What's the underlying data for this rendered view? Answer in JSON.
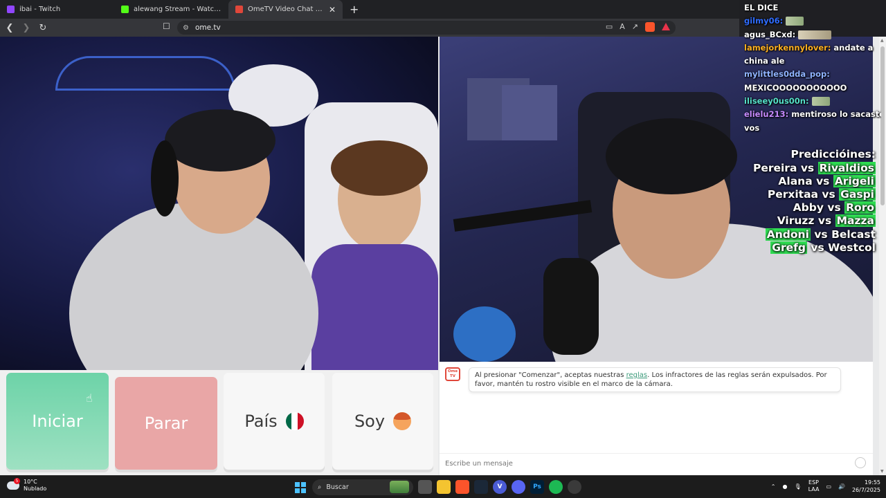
{
  "browser": {
    "tabs": [
      {
        "title": "ibai - Twitch",
        "favicon_color": "#9146ff",
        "active": false
      },
      {
        "title": "alewang Stream - Watch Live on Kick",
        "favicon_color": "#53fc18",
        "active": false
      },
      {
        "title": "OmeTV Video Chat — Omegle",
        "favicon_color": "#e0473a",
        "active": true
      }
    ],
    "new_tab_label": "+",
    "url": "ome.tv"
  },
  "controls": {
    "start_label": "Iniciar",
    "stop_label": "Parar",
    "country_label": "País",
    "gender_label": "Soy"
  },
  "chat": {
    "notice_before": "Al presionar \"Comenzar\", aceptas nuestras ",
    "notice_link": "reglas",
    "notice_after": ". Los infractores de las reglas serán expulsados. Por favor, mantén tu rostro visible en el marco de la cámara.",
    "input_placeholder": "Escribe un mensaje",
    "logo_text": "Ome TV"
  },
  "stream_chat": [
    {
      "user": "",
      "text": "EL DICE",
      "color": "#ffffff"
    },
    {
      "user": "gilmy06:",
      "text": "",
      "color": "#2f6cff",
      "emote": true
    },
    {
      "user": "agus_BCxd:",
      "text": "",
      "color": "#ffffff",
      "emote_wide": true
    },
    {
      "user": "lamejorkennylover:",
      "text": "andate a",
      "color": "#ffb020"
    },
    {
      "user": "",
      "text": "china ale",
      "color": "#ffffff"
    },
    {
      "user": "mylittles0dda_pop:",
      "text": "",
      "color": "#8fb3ff"
    },
    {
      "user": "",
      "text": "MEXICOOOOOOOOOOO",
      "color": "#ffffff"
    },
    {
      "user": "iliseey0us00n:",
      "text": "",
      "color": "#55e0c8",
      "emote": true
    },
    {
      "user": "elielu213:",
      "text": "mentiroso lo sacaste",
      "color": "#c78bff"
    },
    {
      "user": "",
      "text": "vos",
      "color": "#ffffff"
    }
  ],
  "predictions": {
    "title": "Prediccióines:",
    "matches": [
      {
        "a": "Pereira",
        "b": "Rivaldios",
        "winner": "b"
      },
      {
        "a": "Alana",
        "b": "Arigeli",
        "winner": "b"
      },
      {
        "a": "Perxitaa",
        "b": "Gaspi",
        "winner": "b"
      },
      {
        "a": "Abby",
        "b": "Roro",
        "winner": "b"
      },
      {
        "a": "Viruzz",
        "b": "Mazza",
        "winner": "b"
      },
      {
        "a": "Andoni",
        "b": "Belcast",
        "winner": "a"
      },
      {
        "a": "Grefg",
        "b": "Westcol",
        "winner": "a"
      }
    ],
    "vs": "vs",
    "highlight_color": "#2fdc52"
  },
  "taskbar": {
    "weather_temp": "10°C",
    "weather_desc": "Nublado",
    "weather_badge": "5",
    "search_label": "Buscar",
    "lang_top": "ESP",
    "lang_bottom": "LAA",
    "time": "19:55",
    "date": "26/7/2025"
  }
}
